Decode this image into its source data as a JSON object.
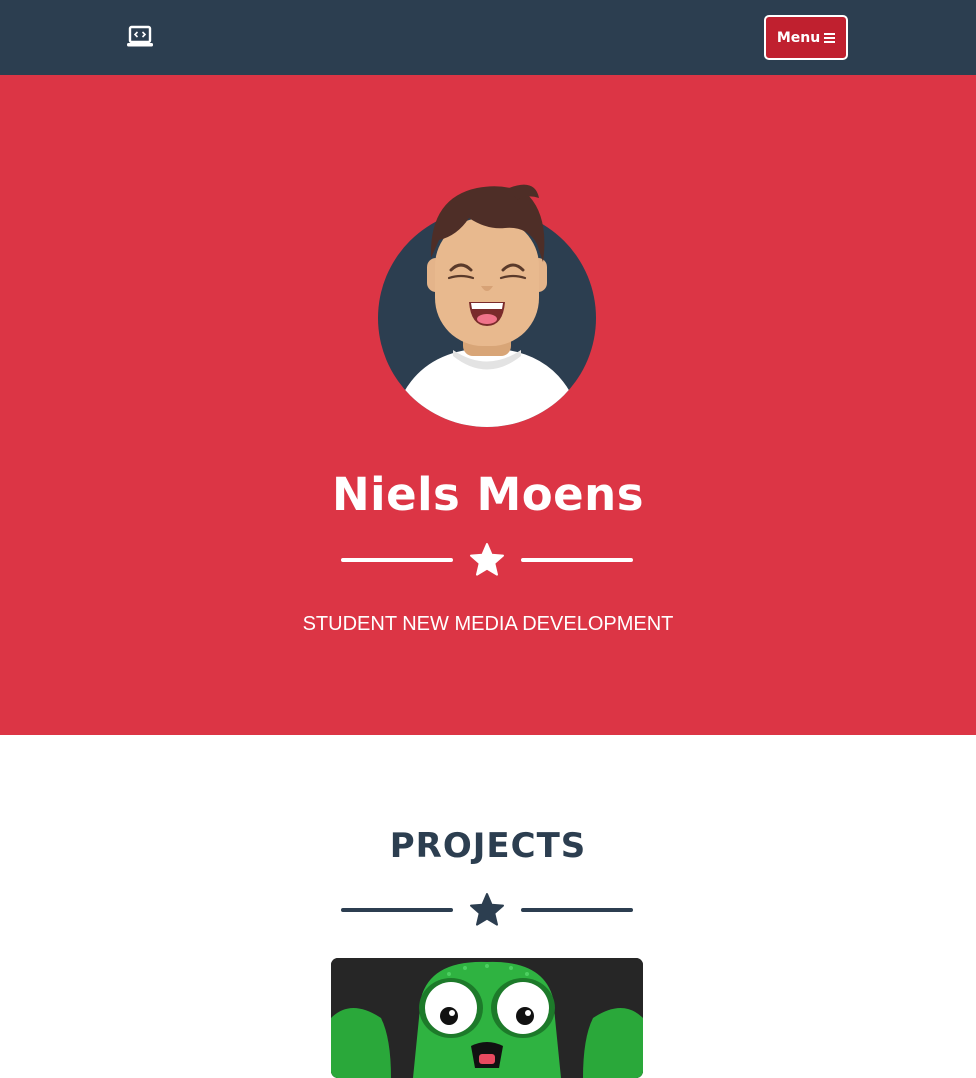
{
  "navbar": {
    "brand_icon": "laptop-code-icon",
    "menu_label": "Menu",
    "menu_icon": "hamburger-icon",
    "background": "#2c3e50",
    "button_color": "#c0202f"
  },
  "masthead": {
    "name": "Niels Moens",
    "subtitle": "STUDENT NEW MEDIA DEVELOPMENT",
    "divider_icon": "star-icon",
    "background": "#dc3545"
  },
  "projects": {
    "title": "PROJECTS",
    "divider_icon": "star-icon",
    "items": [
      {
        "image": "octopus-illustration"
      }
    ]
  }
}
